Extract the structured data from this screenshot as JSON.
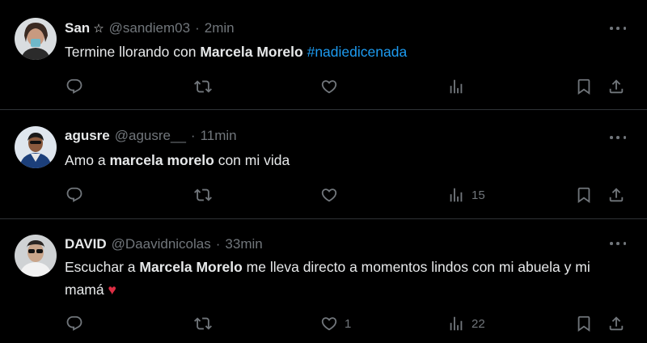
{
  "tweets": [
    {
      "name": "San",
      "badge": "☆",
      "handle": "@sandiem03",
      "sep": "·",
      "time": "2min",
      "text_pre": "Termine llorando con ",
      "text_bold": "Marcela Morelo",
      "text_mid": " ",
      "hashtag": "#nadiedicenada",
      "replies": "",
      "retweets": "",
      "likes": "",
      "views": ""
    },
    {
      "name": "agusre",
      "handle": "@agusre__",
      "sep": "·",
      "time": "11min",
      "text_pre": "Amo a ",
      "text_bold": "marcela morelo",
      "text_post": " con mi vida",
      "replies": "",
      "retweets": "",
      "likes": "",
      "views": "15"
    },
    {
      "name": "DAVID",
      "handle": "@Daavidnicolas",
      "sep": "·",
      "time": "33min",
      "text_pre": "Escuchar a ",
      "text_bold": "Marcela Morelo",
      "text_post": " me lleva directo a momentos lindos con mi abuela y mi mamá ",
      "emoji": "♥",
      "replies": "",
      "retweets": "",
      "likes": "1",
      "views": "22"
    }
  ],
  "colors": {
    "background": "#000000",
    "text": "#e7e9ea",
    "muted": "#71767b",
    "link": "#1d9bf0",
    "divider": "#2f3336",
    "heart_emoji": "#dd2e44"
  },
  "icons": [
    "reply-icon",
    "retweet-icon",
    "like-icon",
    "views-icon",
    "bookmark-icon",
    "share-icon",
    "more-icon"
  ]
}
